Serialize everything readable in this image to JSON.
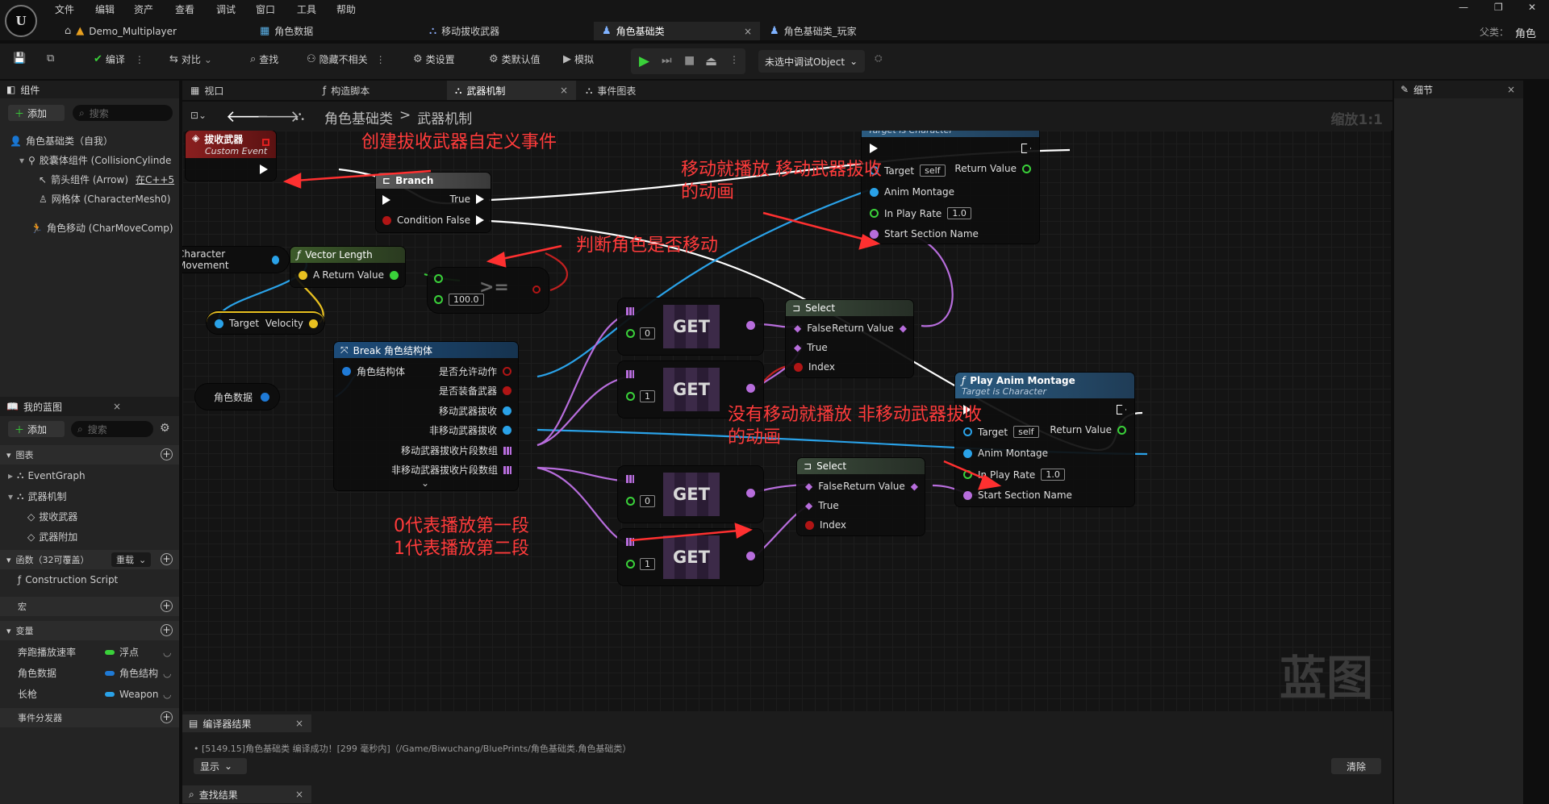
{
  "title_bar": {
    "logo": "U",
    "menu": [
      "文件",
      "编辑",
      "资产",
      "查看",
      "调试",
      "窗口",
      "工具",
      "帮助"
    ],
    "doc_tabs": [
      {
        "label": "Demo_Multiplayer",
        "icon": "home-icon"
      },
      {
        "label": "角色数据",
        "icon": "struct-icon"
      },
      {
        "label": "移动拔收武器",
        "icon": "blueprint-icon"
      },
      {
        "label": "角色基础类",
        "icon": "character-icon",
        "active": true,
        "close": "×"
      },
      {
        "label": "角色基础类_玩家",
        "icon": "character-icon"
      }
    ],
    "parent_label": "父类：",
    "parent_value": "角色",
    "window_controls": [
      "—",
      "❐",
      "✕"
    ]
  },
  "toolbar": {
    "compile": "编译",
    "diff": "对比",
    "find": "查找",
    "hide_unrelated": "隐藏不相关",
    "class_settings": "类设置",
    "class_defaults": "类默认值",
    "simulate": "模拟",
    "debug_object": "未选中调试Object"
  },
  "components_panel": {
    "title": "组件",
    "add": "添加",
    "search_placeholder": "搜索",
    "items": [
      "角色基础类（自我）",
      "胶囊体组件 (CollisionCylinde",
      "箭头组件 (Arrow)",
      "网格体 (CharacterMesh0)",
      "角色移动 (CharMoveComp)"
    ],
    "arrow_cpp": "在C++5"
  },
  "my_blueprint": {
    "title": "我的蓝图",
    "add": "添加",
    "search_placeholder": "搜索",
    "graphs_header": "图表",
    "graphs": [
      "EventGraph",
      "武器机制"
    ],
    "events": [
      "拔收武器",
      "武器附加"
    ],
    "functions_header": "函数（32可覆盖）",
    "override": "重载",
    "functions": [
      "Construction Script"
    ],
    "macros_header": "宏",
    "variables_header": "变量",
    "variables": [
      {
        "name": "奔跑播放速率",
        "type": "浮点",
        "color": "#3ad13a"
      },
      {
        "name": "角色数据",
        "type": "角色结构",
        "color": "#1f7ad6"
      },
      {
        "name": "长枪",
        "type": "Weapon",
        "color": "#2aa2e8"
      }
    ],
    "dispatchers_header": "事件分发器"
  },
  "graph_tabs": [
    {
      "label": "视口"
    },
    {
      "label": "构造脚本"
    },
    {
      "label": "武器机制",
      "active": true,
      "close": "×"
    },
    {
      "label": "事件图表"
    }
  ],
  "breadcrumb": {
    "root": "角色基础类",
    "sep": ">",
    "leaf": "武器机制",
    "zoom": "缩放1:1"
  },
  "nodes": {
    "custom_event": {
      "title": "拔收武器",
      "subtitle": "Custom Event"
    },
    "branch": {
      "title": "Branch",
      "true": "True",
      "condition": "Condition",
      "false": "False"
    },
    "char_movement": "Character Movement",
    "vector_length": {
      "title": "Vector Length",
      "a": "A",
      "ret": "Return Value"
    },
    "compare": {
      "op": ">=",
      "value": "100.0"
    },
    "velocity": {
      "target": "Target",
      "velocity": "Velocity"
    },
    "role_data": "角色数据",
    "break_struct": {
      "title": "Break 角色结构体",
      "input": "角色结构体",
      "outputs": [
        "是否允许动作",
        "是否装备武器",
        "移动武器拔收",
        "非移动武器拔收",
        "移动武器拔收片段数组",
        "非移动武器拔收片段数组"
      ]
    },
    "get_label": "GET",
    "get_indices": [
      "0",
      "1",
      "0",
      "1"
    ],
    "select": {
      "title": "Select",
      "false": "False",
      "true": "True",
      "index": "Index",
      "ret": "Return Value"
    },
    "play_montage": {
      "title": "Play Anim Montage",
      "subtitle": "Target is Character",
      "target": "Target",
      "self": "self",
      "ret": "Return Value",
      "montage": "Anim Montage",
      "rate": "In Play Rate",
      "rate_value": "1.0",
      "section": "Start Section Name"
    }
  },
  "annotations": {
    "custom_event": "创建拔收武器自定义事件",
    "is_moving": "判断角色是否移动",
    "moving_line1": "移动就播放 移动武器拔收",
    "moving_line2": "的动画",
    "not_moving_line1": "没有移动就播放 非移动武器拔收",
    "not_moving_line2": "的动画",
    "index_line1": "0代表播放第一段",
    "index_line2": "1代表播放第二段"
  },
  "watermark": "蓝图",
  "details_panel": {
    "title": "细节",
    "close": "×"
  },
  "compiler": {
    "title": "编译器结果",
    "log": "[5149.15]角色基础类 编译成功！[299 毫秒内]（/Game/Biwuchang/BluePrints/角色基础类.角色基础类）",
    "show": "显示",
    "clear": "清除"
  },
  "find_results": {
    "title": "查找结果"
  }
}
